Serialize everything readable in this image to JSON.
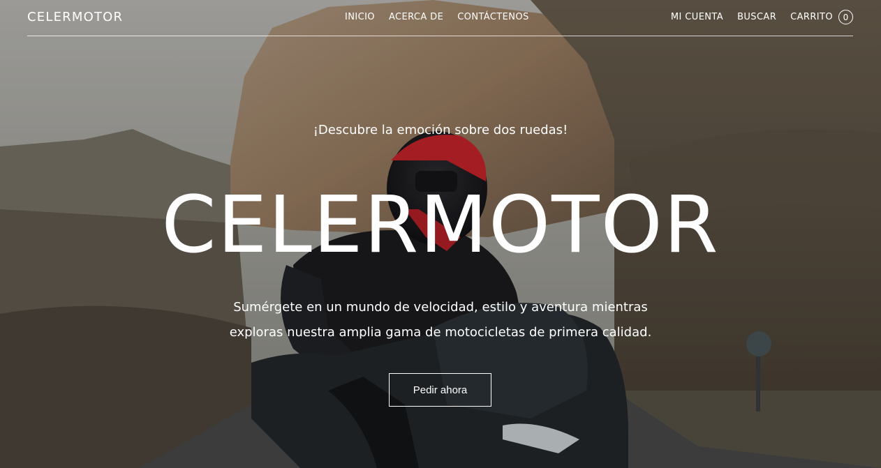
{
  "header": {
    "logo": "CELERMOTOR",
    "nav_center": [
      "INICIO",
      "ACERCA DE",
      "CONTÁCTENOS"
    ],
    "account": "MI CUENTA",
    "search": "BUSCAR",
    "cart_label": "CARRITO",
    "cart_count": "0"
  },
  "hero": {
    "tagline": "¡Descubre la emoción sobre dos ruedas!",
    "title": "CELERMOTOR",
    "subtitle_line1": "Sumérgete en un mundo de velocidad, estilo y aventura mientras",
    "subtitle_line2": "exploras nuestra amplia gama de motocicletas de primera calidad.",
    "cta": "Pedir ahora"
  },
  "colors": {
    "text": "#ffffff",
    "sky": "#d9d9d6",
    "rock": "#a98a6e",
    "motorcycle": "#1f2427",
    "helmet_accent": "#d2262b"
  }
}
